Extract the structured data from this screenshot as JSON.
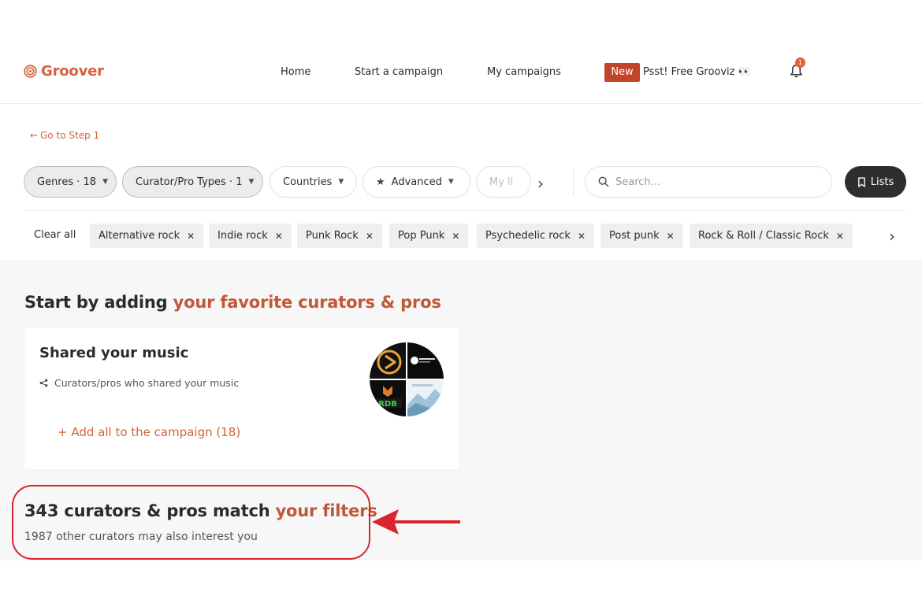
{
  "header": {
    "logo_text": "Groover",
    "nav": [
      "Home",
      "Start a campaign",
      "My campaigns"
    ],
    "new_badge": "New",
    "groovi_text": "Psst! Free Grooviz 👀",
    "notification_count": "1"
  },
  "back_link": "Go to Step 1",
  "filters": {
    "genres": "Genres · 18",
    "curator_types": "Curator/Pro Types · 1",
    "countries": "Countries",
    "advanced": "Advanced",
    "my_lists_partial": "My li",
    "search_placeholder": "Search...",
    "lists_button": "Lists"
  },
  "tags": {
    "clear_all": "Clear all",
    "items": [
      "Alternative rock",
      "Indie rock",
      "Punk Rock",
      "Pop Punk",
      "Psychedelic rock",
      "Post punk",
      "Rock & Roll / Classic Rock"
    ]
  },
  "favorites": {
    "title_part1": "Start by adding ",
    "title_highlight": "your favorite curators & pros",
    "card_title": "Shared your music",
    "card_subtitle": "Curators/pros who shared your music",
    "add_all": "+ Add all to the campaign (18)"
  },
  "results": {
    "title_part1": "343 curators & pros match ",
    "title_highlight": "your filters",
    "subtitle": "1987 other curators may also interest you"
  },
  "colors": {
    "brand": "#d4623b",
    "highlight_text": "#c0583a",
    "annotation_red": "#d8242c",
    "dark_button": "#2e2e2e"
  }
}
